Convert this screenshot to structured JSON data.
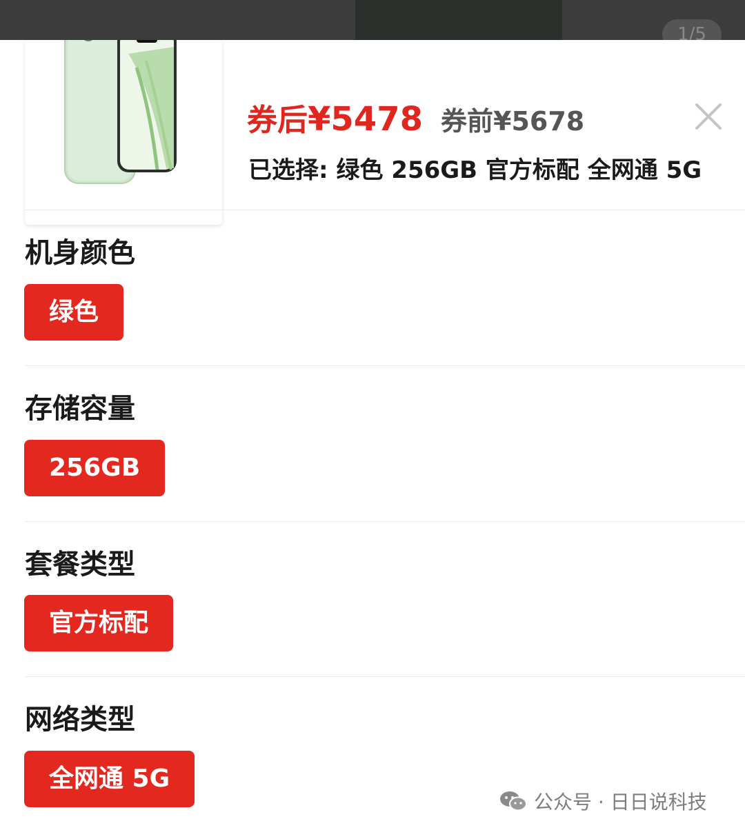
{
  "header": {
    "pager_text": "1/5"
  },
  "product": {
    "price_after_label": "券后",
    "price_after_value": "¥5478",
    "price_before_label": "券前",
    "price_before_value": "¥5678",
    "selected_label": "已选择:",
    "selected_value": "绿色 256GB 官方标配 全网通 5G"
  },
  "sections": {
    "color": {
      "title": "机身颜色",
      "option": "绿色"
    },
    "storage": {
      "title": "存储容量",
      "option": "256GB"
    },
    "package": {
      "title": "套餐类型",
      "option": "官方标配"
    },
    "network": {
      "title": "网络类型",
      "option": "全网通 5G"
    }
  },
  "watermark": {
    "text": "公众号 · 日日说科技"
  },
  "icons": {
    "close": "close-icon",
    "wechat": "wechat-icon"
  },
  "colors": {
    "accent": "#e3291f",
    "price": "#e0271f",
    "phone": "#c7e3c6"
  }
}
